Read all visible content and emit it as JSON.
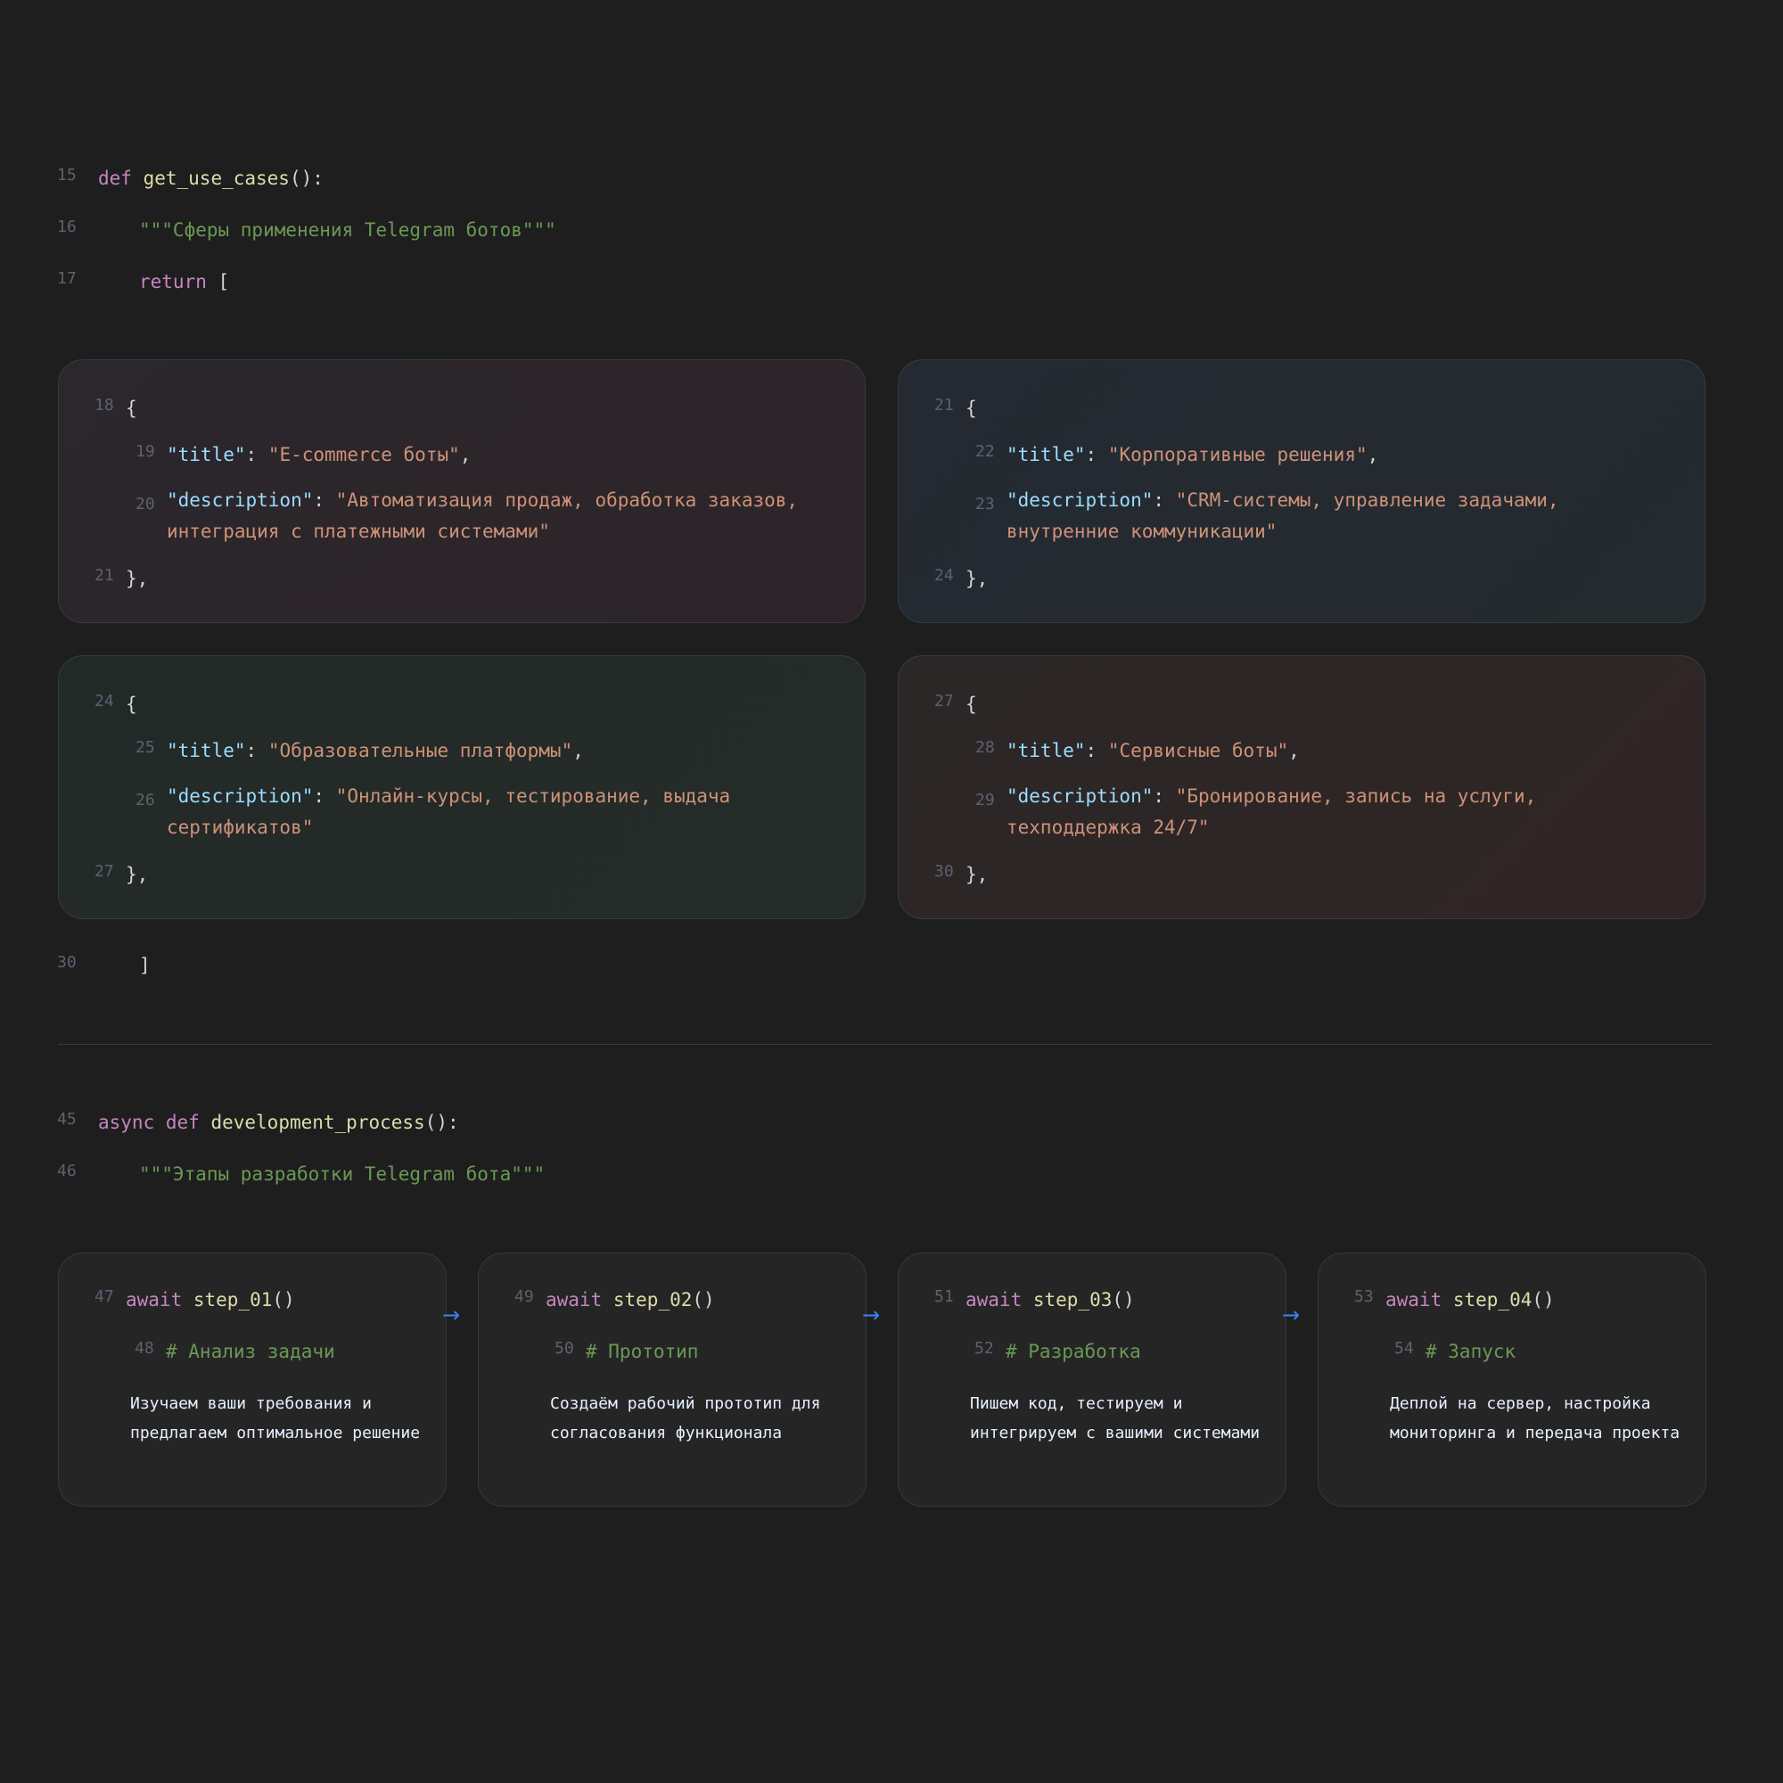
{
  "use_cases_fn": {
    "ln_def": "15",
    "def": "def",
    "name": "get_use_cases",
    "sig_tail": "():",
    "ln_doc": "16",
    "docstring": "\"\"\"Сферы применения Telegram ботов\"\"\"",
    "ln_return": "17",
    "return": "return",
    "bracket_open": "[",
    "ln_close": "30",
    "bracket_close": "]"
  },
  "cards": [
    {
      "ln_open": "18",
      "ln_title": "19",
      "ln_desc": "20",
      "ln_close": "21",
      "title_key": "\"title\"",
      "title_val": "\"E-commerce боты\"",
      "desc_key": "\"description\"",
      "desc_val": "\"Автоматизация продаж, обработка заказов, интеграция с платежными системами\""
    },
    {
      "ln_open": "21",
      "ln_title": "22",
      "ln_desc": "23",
      "ln_close": "24",
      "title_key": "\"title\"",
      "title_val": "\"Корпоративные решения\"",
      "desc_key": "\"description\"",
      "desc_val": "\"CRM-системы, управление задачами, внутренние коммуникации\""
    },
    {
      "ln_open": "24",
      "ln_title": "25",
      "ln_desc": "26",
      "ln_close": "27",
      "title_key": "\"title\"",
      "title_val": "\"Образовательные платформы\"",
      "desc_key": "\"description\"",
      "desc_val": "\"Онлайн-курсы, тестирование, выдача сертификатов\""
    },
    {
      "ln_open": "27",
      "ln_title": "28",
      "ln_desc": "29",
      "ln_close": "30",
      "title_key": "\"title\"",
      "title_val": "\"Сервисные боты\"",
      "desc_key": "\"description\"",
      "desc_val": "\"Бронирование, запись на услуги, техподдержка 24/7\""
    }
  ],
  "punct": {
    "brace_open": "{",
    "brace_close": "},",
    "colon": ": ",
    "comma": ","
  },
  "process_fn": {
    "ln_def": "45",
    "async": "async",
    "def": "def",
    "name": "development_process",
    "sig_tail": "():",
    "ln_doc": "46",
    "docstring": "\"\"\"Этапы разработки Telegram бота\"\"\""
  },
  "steps": [
    {
      "ln_call": "47",
      "ln_comment": "48",
      "await": "await",
      "call": "step_01",
      "parens": "()",
      "comment": "# Анализ задачи",
      "text": "Изучаем ваши требования и предлагаем оптимальное решение"
    },
    {
      "ln_call": "49",
      "ln_comment": "50",
      "await": "await",
      "call": "step_02",
      "parens": "()",
      "comment": "# Прототип",
      "text": "Создаём рабочий прототип для согласования функционала"
    },
    {
      "ln_call": "51",
      "ln_comment": "52",
      "await": "await",
      "call": "step_03",
      "parens": "()",
      "comment": "# Разработка",
      "text": "Пишем код, тестируем и интегрируем с вашими системами"
    },
    {
      "ln_call": "53",
      "ln_comment": "54",
      "await": "await",
      "call": "step_04",
      "parens": "()",
      "comment": "# Запуск",
      "text": "Деплой на сервер, настройка мониторинга и передача проекта"
    }
  ],
  "arrow_glyph": "→",
  "colors": {
    "background": "#1e1e1e",
    "keyword": "#c586c0",
    "function": "#dcdcaa",
    "key": "#9cdcfe",
    "string": "#ce9178",
    "comment": "#6a9955",
    "arrow": "#3b82f6"
  }
}
